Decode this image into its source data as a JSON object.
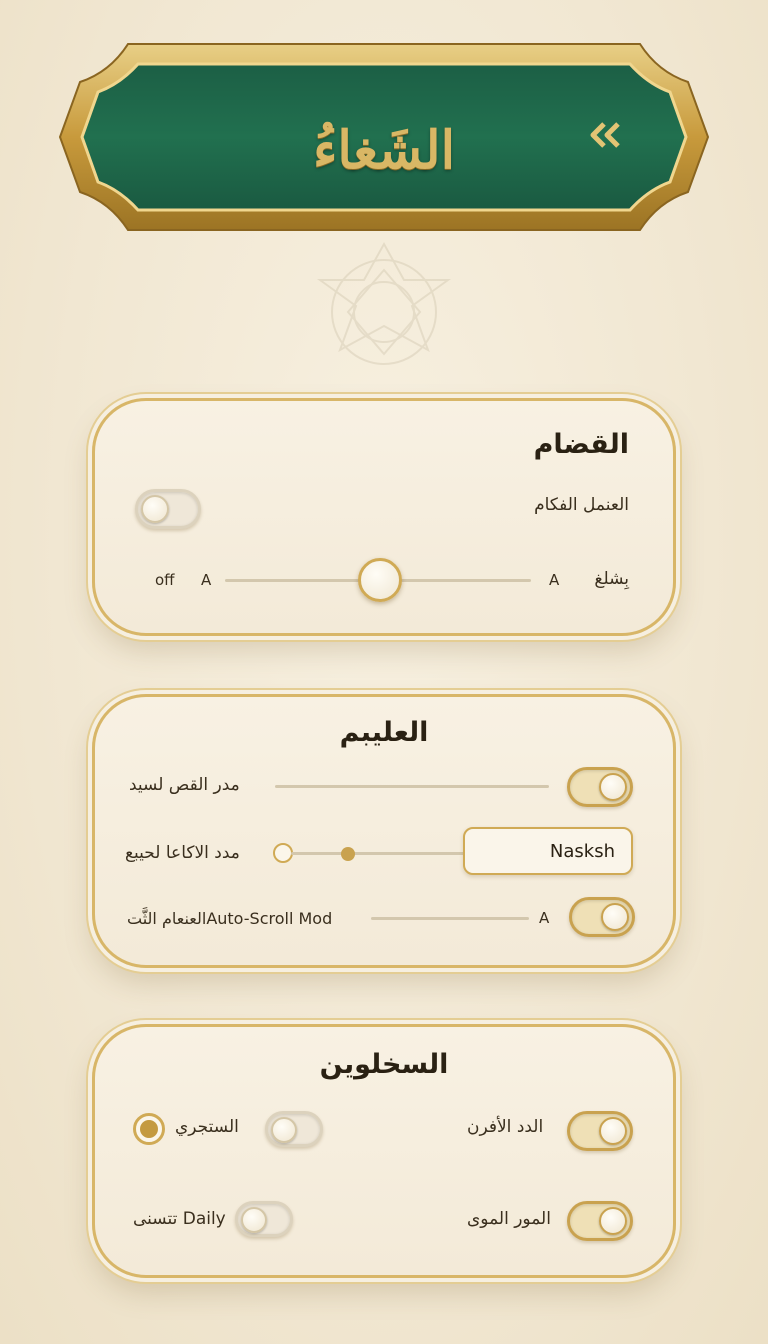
{
  "header": {
    "title": "الشَغاءُ",
    "back_icon": "double-chevron-left-icon"
  },
  "colors": {
    "banner_green": "#1f6a4c",
    "gold": "#c9a24f",
    "background": "#f1e7d2"
  },
  "card1": {
    "title": "القضام",
    "toggle_label": "العنمل الفكام",
    "toggle_on": false,
    "slider": {
      "left_label": "off",
      "left_a": "A",
      "right_a": "A",
      "right_label": "بِشلغ",
      "value_fraction": 0.5
    }
  },
  "card2": {
    "title": "العليبم",
    "row1_label": "مدر القص لسيد",
    "row1_toggle_on": true,
    "row2_label": "مدد الاكاعا لحيبع",
    "font_value": "Nasksh",
    "row3_label": "العنعام الثَّتAuto-Scroll Mod",
    "row3_a": "A",
    "row3_toggle_on": true
  },
  "card3": {
    "title": "السخلوين",
    "row1_right_label": "الدد الأفرن",
    "row1_right_on": true,
    "row1_left_label": "الستجري",
    "row1_left_on": false,
    "row1_radio_selected": true,
    "row2_right_label": "المور الموى",
    "row2_right_on": true,
    "row2_left_label": "تتسنى Daily",
    "row2_left_on": false
  }
}
